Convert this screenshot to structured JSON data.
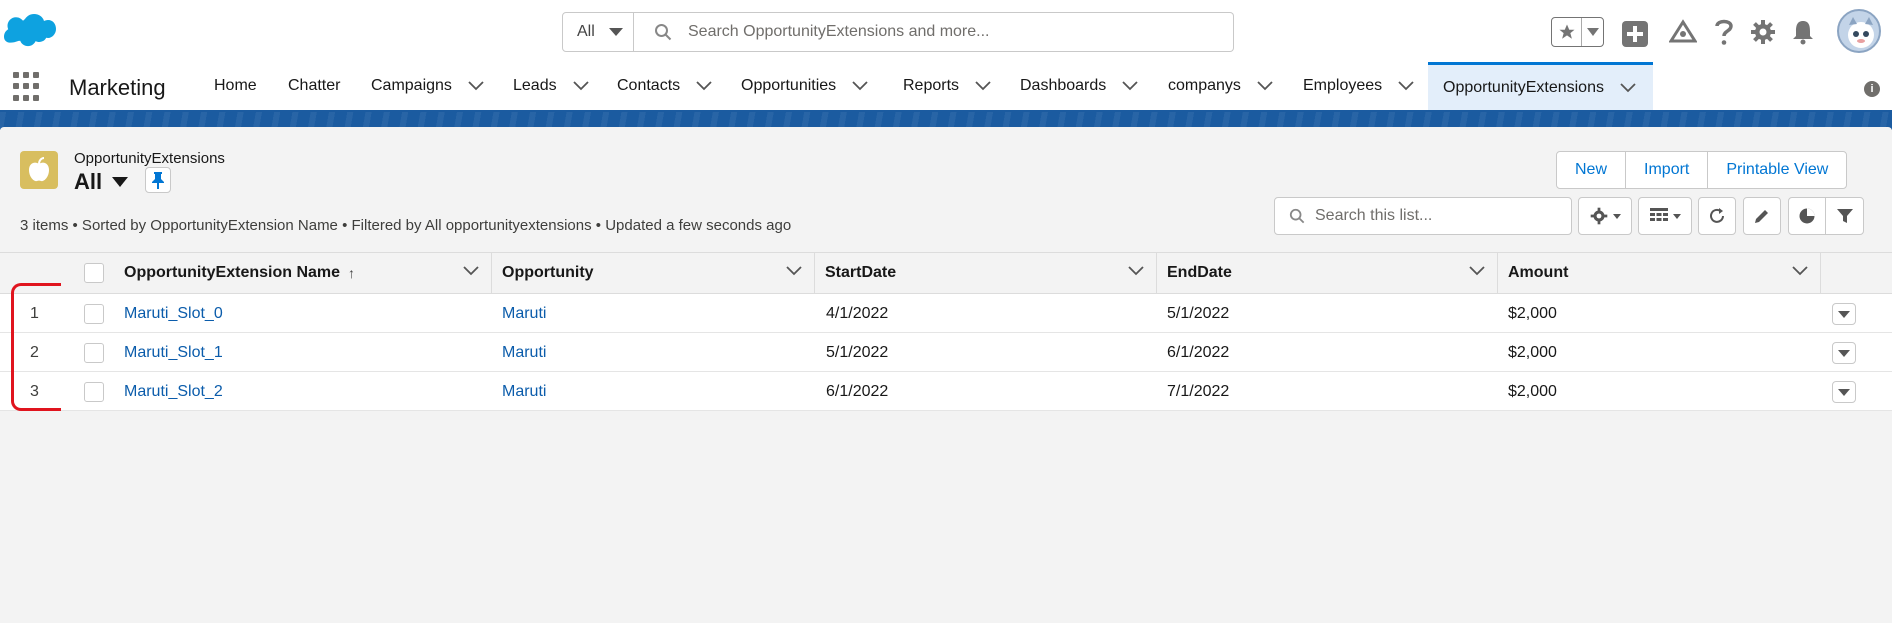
{
  "global": {
    "search_scope": "All",
    "search_placeholder": "Search OpportunityExtensions and more..."
  },
  "nav": {
    "app_name": "Marketing",
    "items": [
      {
        "label": "Home",
        "has_menu": false
      },
      {
        "label": "Chatter",
        "has_menu": false
      },
      {
        "label": "Campaigns",
        "has_menu": true
      },
      {
        "label": "Leads",
        "has_menu": true
      },
      {
        "label": "Contacts",
        "has_menu": true
      },
      {
        "label": "Opportunities",
        "has_menu": true
      },
      {
        "label": "Reports",
        "has_menu": true
      },
      {
        "label": "Dashboards",
        "has_menu": true
      },
      {
        "label": "companys",
        "has_menu": true
      },
      {
        "label": "Employees",
        "has_menu": true
      },
      {
        "label": "OpportunityExtensions",
        "has_menu": true,
        "active": true
      }
    ]
  },
  "list": {
    "object_label": "OpportunityExtensions",
    "view_name": "All",
    "meta": "3 items • Sorted by OpportunityExtension Name • Filtered by All opportunityextensions • Updated a few seconds ago",
    "actions": [
      "New",
      "Import",
      "Printable View"
    ],
    "search_placeholder": "Search this list..."
  },
  "table": {
    "columns": [
      "OpportunityExtension Name",
      "Opportunity",
      "StartDate",
      "EndDate",
      "Amount"
    ],
    "sort_indicator": "↑",
    "rows": [
      {
        "num": "1",
        "name": "Maruti_Slot_0",
        "opportunity": "Maruti",
        "start": "4/1/2022",
        "end": "5/1/2022",
        "amount": "$2,000"
      },
      {
        "num": "2",
        "name": "Maruti_Slot_1",
        "opportunity": "Maruti",
        "start": "5/1/2022",
        "end": "6/1/2022",
        "amount": "$2,000"
      },
      {
        "num": "3",
        "name": "Maruti_Slot_2",
        "opportunity": "Maruti",
        "start": "6/1/2022",
        "end": "7/1/2022",
        "amount": "$2,000"
      }
    ]
  },
  "colors": {
    "brand_blue": "#0176d3",
    "link_blue": "#0b5cab",
    "band_blue": "#1b5ba0",
    "object_icon": "#d8be5f",
    "annotation_red": "#e0141e"
  }
}
